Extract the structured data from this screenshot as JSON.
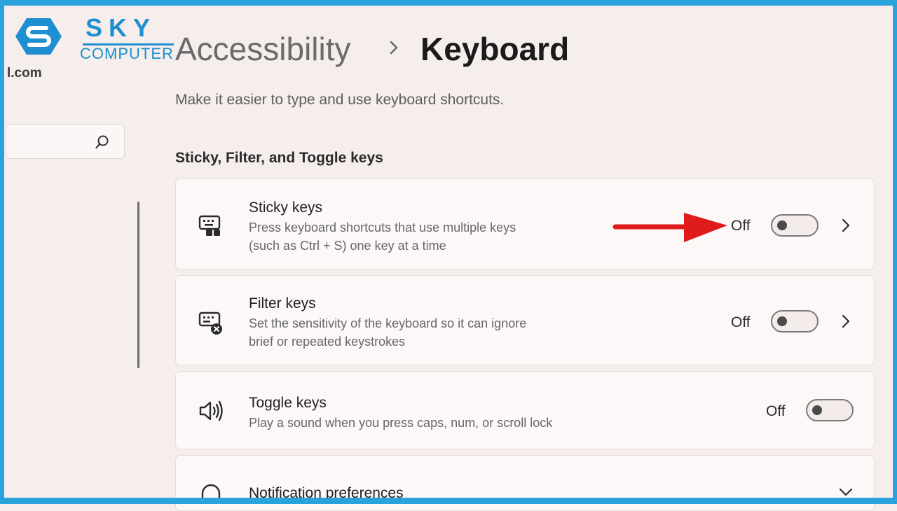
{
  "watermark": {
    "brand_top": "SKY",
    "brand_bottom": "COMPUTER"
  },
  "sidebar": {
    "email_suffix": "l.com",
    "search": {
      "placeholder": ""
    }
  },
  "header": {
    "breadcrumb_parent": "Accessibility",
    "breadcrumb_current": "Keyboard",
    "subtitle": "Make it easier to type and use keyboard shortcuts."
  },
  "section": {
    "title": "Sticky, Filter, and Toggle keys",
    "items": [
      {
        "title": "Sticky keys",
        "desc_line1": "Press keyboard shortcuts that use multiple keys",
        "desc_line2": "(such as Ctrl + S) one key at a time",
        "state": "Off",
        "icon": "keyboard-sticky-icon",
        "has_chevron": true
      },
      {
        "title": "Filter keys",
        "desc_line1": "Set the sensitivity of the keyboard so it can ignore",
        "desc_line2": "brief or repeated keystrokes",
        "state": "Off",
        "icon": "keyboard-filter-icon",
        "has_chevron": true
      },
      {
        "title": "Toggle keys",
        "desc_line1": "Play a sound when you press caps, num, or scroll lock",
        "state": "Off",
        "icon": "speaker-icon",
        "has_chevron": false
      },
      {
        "title": "Notification preferences",
        "icon": "bell-icon",
        "expandable": true
      }
    ]
  },
  "annotation": {
    "arrow_color": "#e01b1b",
    "points_to": "Sticky keys Off"
  },
  "colors": {
    "frame": "#29a3dd",
    "brand": "#1e8fd0",
    "background": "#f6eeec"
  }
}
